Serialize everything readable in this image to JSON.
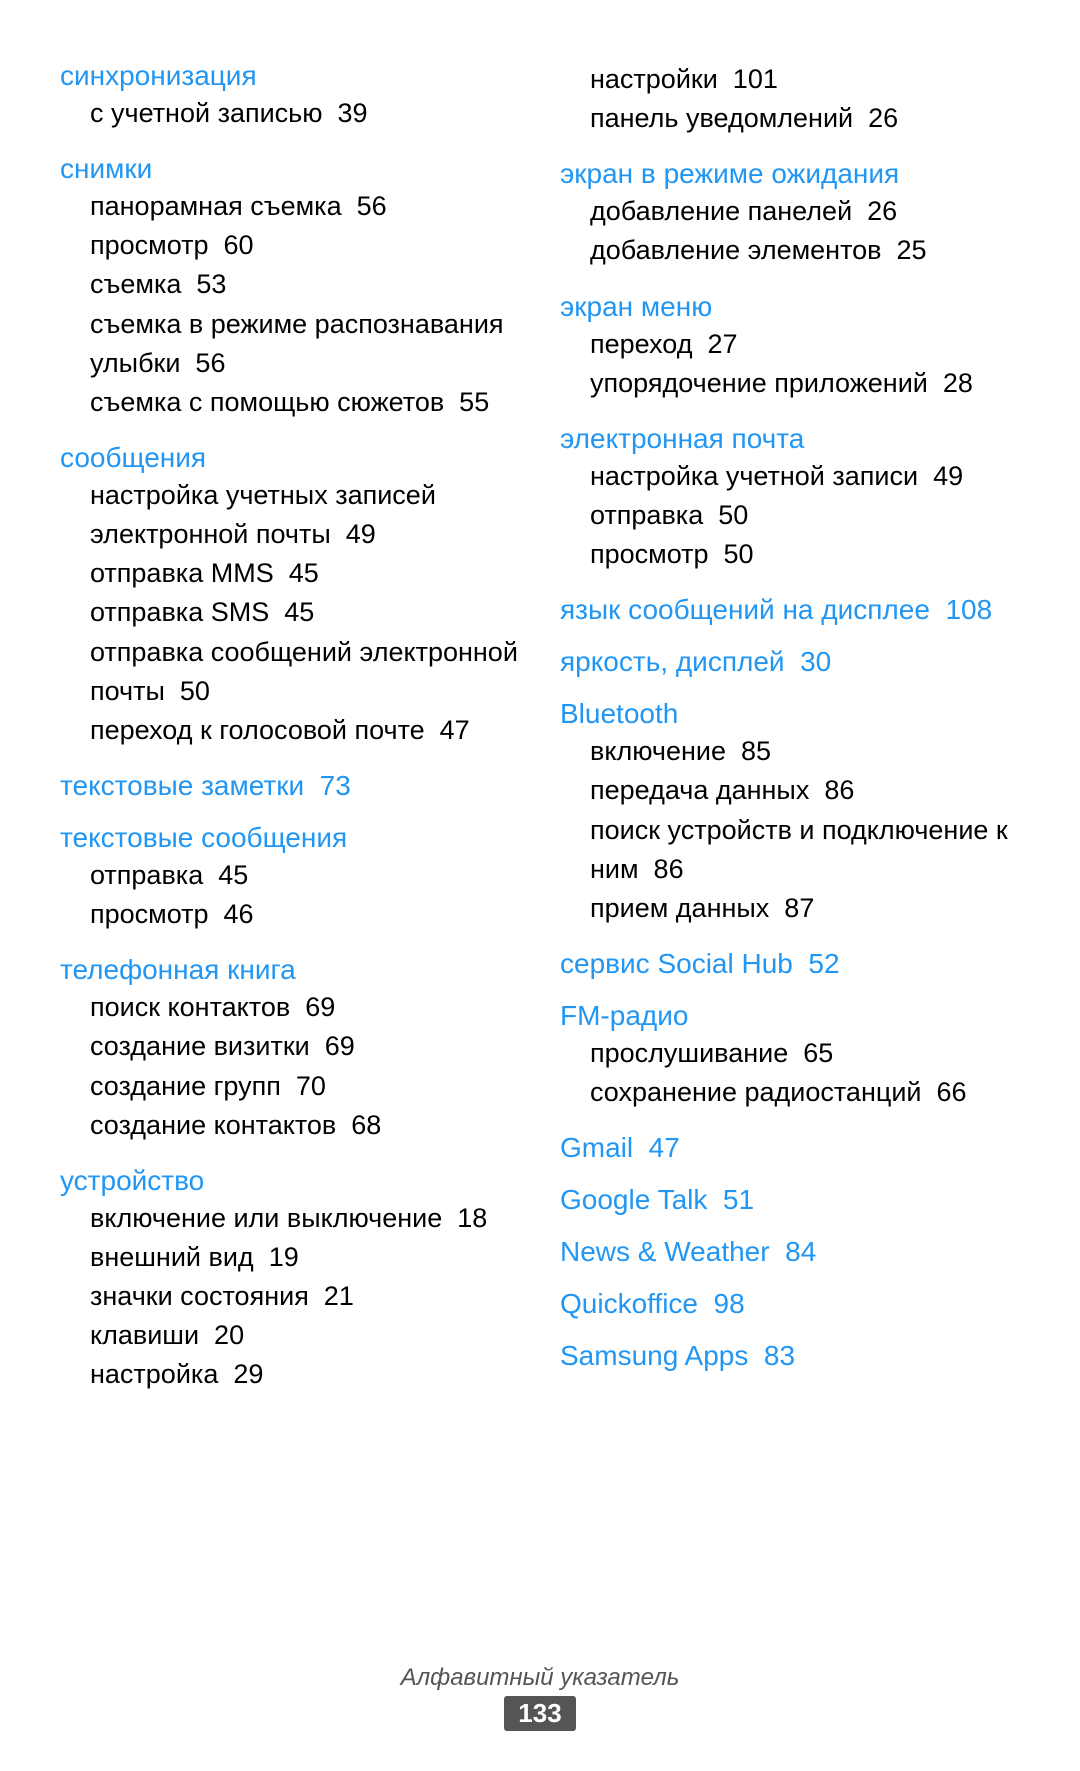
{
  "columns": [
    {
      "id": "left",
      "sections": [
        {
          "heading": "синхронизация",
          "items": [
            {
              "text": "с учетной записью",
              "number": "39"
            }
          ]
        },
        {
          "heading": "снимки",
          "items": [
            {
              "text": "панорамная съемка",
              "number": "56"
            },
            {
              "text": "просмотр",
              "number": "60"
            },
            {
              "text": "съемка",
              "number": "53"
            },
            {
              "text": "съемка в режиме распознавания улыбки",
              "number": "56"
            },
            {
              "text": "съемка с помощью сюжетов",
              "number": "55"
            }
          ]
        },
        {
          "heading": "сообщения",
          "items": [
            {
              "text": "настройка учетных записей электронной почты",
              "number": "49"
            },
            {
              "text": "отправка MMS",
              "number": "45"
            },
            {
              "text": "отправка SMS",
              "number": "45"
            },
            {
              "text": "отправка сообщений электронной почты",
              "number": "50"
            },
            {
              "text": "переход к голосовой почте",
              "number": "47"
            }
          ]
        },
        {
          "heading": "текстовые заметки",
          "number": "73",
          "items": []
        },
        {
          "heading": "текстовые сообщения",
          "items": [
            {
              "text": "отправка",
              "number": "45"
            },
            {
              "text": "просмотр",
              "number": "46"
            }
          ]
        },
        {
          "heading": "телефонная книга",
          "items": [
            {
              "text": "поиск контактов",
              "number": "69"
            },
            {
              "text": "создание визитки",
              "number": "69"
            },
            {
              "text": "создание групп",
              "number": "70"
            },
            {
              "text": "создание контактов",
              "number": "68"
            }
          ]
        },
        {
          "heading": "устройство",
          "items": [
            {
              "text": "включение или выключение",
              "number": "18"
            },
            {
              "text": "внешний вид",
              "number": "19"
            },
            {
              "text": "значки состояния",
              "number": "21"
            },
            {
              "text": "клавиши",
              "number": "20"
            },
            {
              "text": "настройка",
              "number": "29"
            }
          ]
        }
      ]
    },
    {
      "id": "right",
      "sections": [
        {
          "heading": null,
          "items": [
            {
              "text": "настройки",
              "number": "101"
            },
            {
              "text": "панель уведомлений",
              "number": "26"
            }
          ]
        },
        {
          "heading": "экран в режиме ожидания",
          "items": [
            {
              "text": "добавление панелей",
              "number": "26"
            },
            {
              "text": "добавление элементов",
              "number": "25"
            }
          ]
        },
        {
          "heading": "экран меню",
          "items": [
            {
              "text": "переход",
              "number": "27"
            },
            {
              "text": "упорядочение приложений",
              "number": "28"
            }
          ]
        },
        {
          "heading": "электронная почта",
          "items": [
            {
              "text": "настройка учетной записи",
              "number": "49"
            },
            {
              "text": "отправка",
              "number": "50"
            },
            {
              "text": "просмотр",
              "number": "50"
            }
          ]
        },
        {
          "heading": "язык сообщений на дисплее",
          "number": "108",
          "items": []
        },
        {
          "heading": "яркость, дисплей",
          "number": "30",
          "items": []
        },
        {
          "heading": "Bluetooth",
          "items": [
            {
              "text": "включение",
              "number": "85"
            },
            {
              "text": "передача данных",
              "number": "86"
            },
            {
              "text": "поиск устройств и подключение к ним",
              "number": "86"
            },
            {
              "text": "прием данных",
              "number": "87"
            }
          ]
        },
        {
          "heading": "сервис Social Hub",
          "number": "52",
          "items": []
        },
        {
          "heading": "FM-радио",
          "items": [
            {
              "text": "прослушивание",
              "number": "65"
            },
            {
              "text": "сохранение радиостанций",
              "number": "66"
            }
          ]
        },
        {
          "heading": "Gmail",
          "number": "47",
          "items": []
        },
        {
          "heading": "Google Talk",
          "number": "51",
          "items": []
        },
        {
          "heading": "News & Weather",
          "number": "84",
          "items": []
        },
        {
          "heading": "Quickoffice",
          "number": "98",
          "items": []
        },
        {
          "heading": "Samsung Apps",
          "number": "83",
          "items": []
        }
      ]
    }
  ],
  "footer": {
    "label": "Алфавитный указатель",
    "page": "133"
  }
}
